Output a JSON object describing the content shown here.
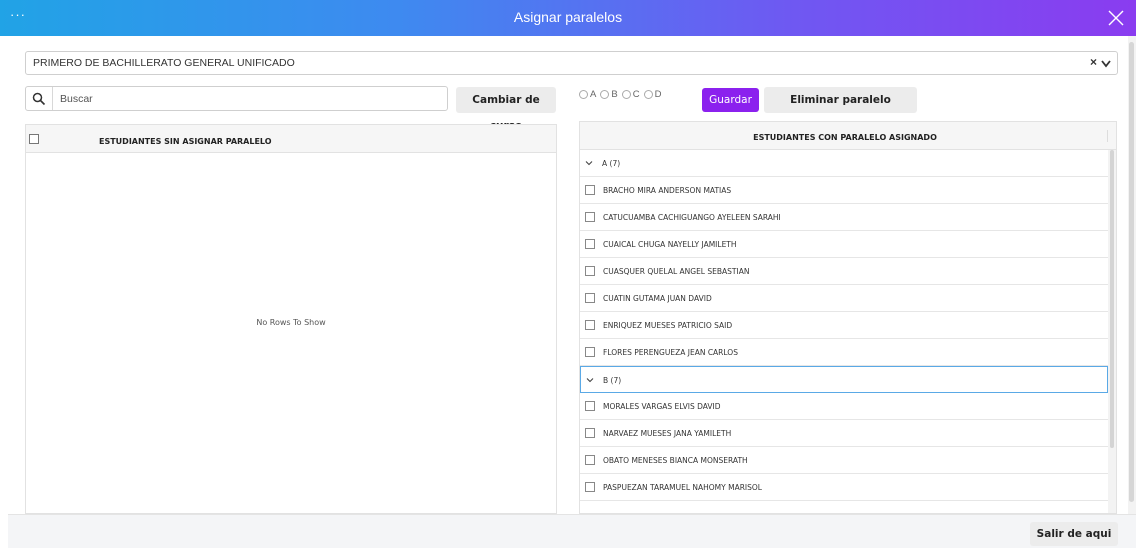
{
  "window": {
    "title": "Asignar paralelos",
    "menu_icon": "ellipsis-icon",
    "close_icon": "close-icon"
  },
  "course": {
    "selected": "PRIMERO DE BACHILLERATO GENERAL UNIFICADO",
    "clear_label": "×",
    "chevron": "⌄"
  },
  "search": {
    "placeholder": "Buscar",
    "value": ""
  },
  "toolbar": {
    "cambiar_label": "Cambiar de curso",
    "paralelos": [
      "A",
      "B",
      "C",
      "D"
    ],
    "guardar_label": "Guardar",
    "eliminar_label": "Eliminar paralelo asignado"
  },
  "left_grid": {
    "header": "ESTUDIANTES SIN ASIGNAR PARALELO",
    "empty_text": "No Rows To Show"
  },
  "right_grid": {
    "header": "ESTUDIANTES CON PARALELO ASIGNADO",
    "rows": [
      {
        "type": "group",
        "label": "A (7)"
      },
      {
        "type": "student",
        "label": "BRACHO MIRA ANDERSON MATIAS"
      },
      {
        "type": "student",
        "label": "CATUCUAMBA CACHIGUANGO AYELEEN SARAHI"
      },
      {
        "type": "student",
        "label": "CUAICAL CHUGA NAYELLY JAMILETH"
      },
      {
        "type": "student",
        "label": "CUASQUER QUELAL ANGEL SEBASTIAN"
      },
      {
        "type": "student",
        "label": "CUATIN GUTAMA JUAN DAVID"
      },
      {
        "type": "student",
        "label": "ENRIQUEZ MUESES PATRICIO SAID"
      },
      {
        "type": "student",
        "label": "FLORES PERENGUEZA JEAN CARLOS"
      },
      {
        "type": "group",
        "label": "B (7)",
        "focused": true
      },
      {
        "type": "student",
        "label": "MORALES VARGAS ELVIS DAVID"
      },
      {
        "type": "student",
        "label": "NARVAEZ MUESES JANA YAMILETH"
      },
      {
        "type": "student",
        "label": "OBATO MENESES BIANCA MONSERATH"
      },
      {
        "type": "student",
        "label": "PASPUEZAN TARAMUEL NAHOMY MARISOL"
      }
    ]
  },
  "footer": {
    "salir_label": "Salir de aqui"
  },
  "colors": {
    "title_gradient_start": "#21a3e6",
    "title_gradient_end": "#8a3cf0",
    "primary_button": "#8b21ee",
    "focus_border": "#5aa9e6"
  }
}
